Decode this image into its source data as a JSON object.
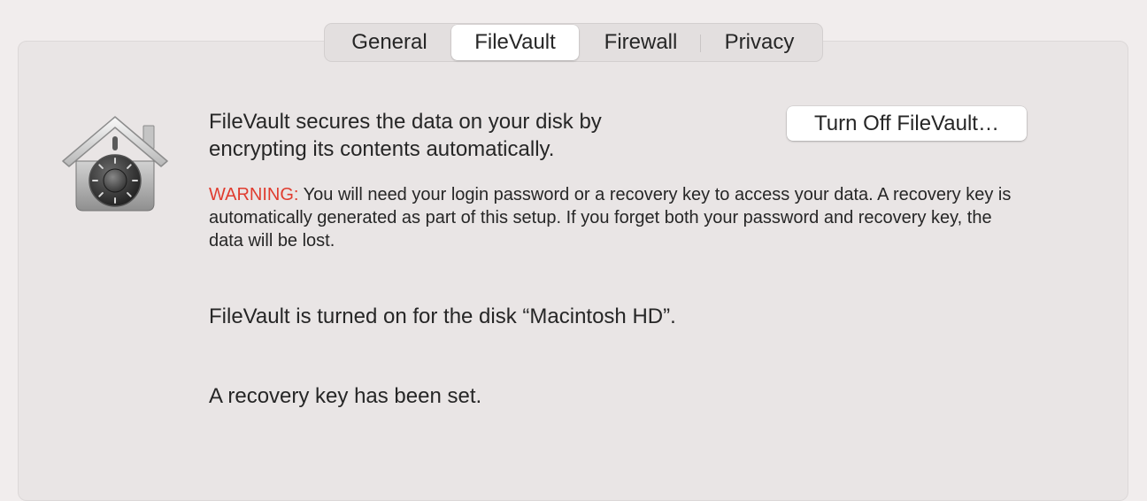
{
  "tabs": {
    "general": "General",
    "filevault": "FileVault",
    "firewall": "Firewall",
    "privacy": "Privacy",
    "selected": "FileVault"
  },
  "filevault": {
    "icon": "vault-house-icon",
    "description": "FileVault secures the data on your disk by encrypting its contents automatically.",
    "turn_off_button": "Turn Off FileVault…",
    "warning_label": "WARNING:",
    "warning_text": " You will need your login password or a recovery key to access your data. A recovery key is automatically generated as part of this setup. If you forget both your password and recovery key, the data will be lost.",
    "status": "FileVault is turned on for the disk “Macintosh HD”.",
    "recovery_status": "A recovery key has been set."
  },
  "colors": {
    "warning": "#e03c2f",
    "window_bg": "#f1eded",
    "panel_bg": "#e9e5e5"
  }
}
